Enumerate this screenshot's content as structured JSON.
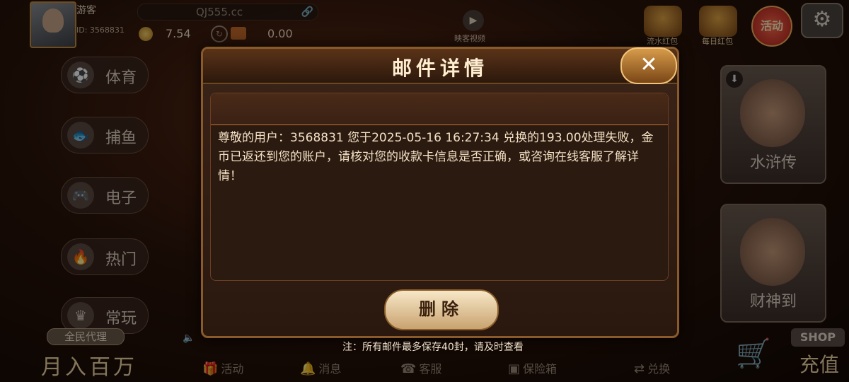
{
  "user": {
    "name": "游客",
    "id": "ID: 3568831",
    "domain": "QJ555.cc",
    "coins": "7.54",
    "bank": "0.00"
  },
  "top_icons": [
    {
      "label": "流水红包",
      "icon": "red-envelope-icon"
    },
    {
      "label": "每日红包",
      "icon": "gift-icon"
    },
    {
      "label": "活动",
      "icon": "activity-icon"
    }
  ],
  "video": {
    "label": "映客视频",
    "icon": "play-icon"
  },
  "nav": [
    {
      "label": "体育",
      "icon": "soccer-ball-icon"
    },
    {
      "label": "捕鱼",
      "icon": "fish-icon"
    },
    {
      "label": "电子",
      "icon": "gamepad-icon"
    },
    {
      "label": "热门",
      "icon": "flame-icon"
    },
    {
      "label": "常玩",
      "icon": "crown-icon"
    }
  ],
  "promo": {
    "badge": "全民代理",
    "slogan": "月入百万"
  },
  "games": [
    {
      "label": "水浒传",
      "icon": "download-icon"
    },
    {
      "label": "财神到"
    }
  ],
  "shop": {
    "badge": "SHOP",
    "label": "充值",
    "icon": "cart-icon"
  },
  "bottom_nav": [
    {
      "label": "活动",
      "icon": "gift-icon"
    },
    {
      "label": "消息",
      "icon": "bell-icon"
    },
    {
      "label": "客服",
      "icon": "headset-icon"
    },
    {
      "label": "保险箱",
      "icon": "safe-icon"
    },
    {
      "label": "兑换",
      "icon": "exchange-icon"
    }
  ],
  "modal": {
    "title": "邮件详情",
    "close_label": "✕",
    "content": "尊敬的用户：3568831 您于2025-05-16 16:27:34  兑换的193.00处理失败，金币已返还到您的账户，请核对您的收款卡信息是否正确，或咨询在线客服了解详情！",
    "delete_label": "删除",
    "notice": "注：所有邮件最多保存40封，请及时查看"
  },
  "colors": {
    "modal_border": "#8a5a2a",
    "title_text": "#ffeed0",
    "button_gold": "#d79b4a"
  }
}
